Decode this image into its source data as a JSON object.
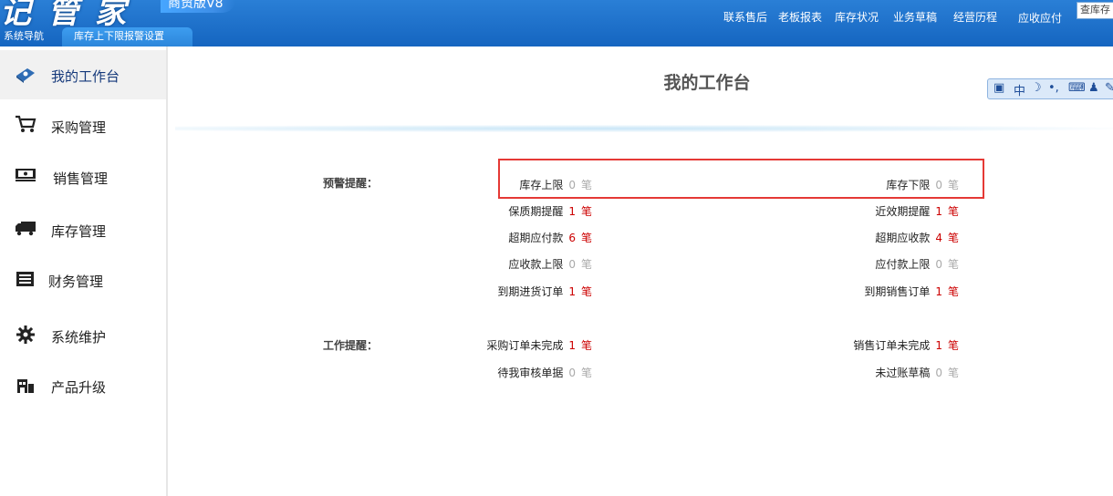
{
  "header": {
    "brand": "记管家",
    "edition": "商贸版V8",
    "tabs": [
      "系统导航",
      "库存上下限报警设置"
    ],
    "nav": [
      "联系售后",
      "老板报表",
      "库存状况",
      "业务草稿",
      "经营历程",
      "应收应付"
    ],
    "search_value": "查库存"
  },
  "sidebar": {
    "items": [
      {
        "label": "我的工作台",
        "icon": "dashboard-icon",
        "active": true
      },
      {
        "label": "采购管理",
        "icon": "cart-icon"
      },
      {
        "label": "销售管理",
        "icon": "cash-icon"
      },
      {
        "label": "库存管理",
        "icon": "truck-icon"
      },
      {
        "label": "财务管理",
        "icon": "ledger-icon"
      },
      {
        "label": "系统维护",
        "icon": "gear-icon"
      },
      {
        "label": "产品升级",
        "icon": "upgrade-icon"
      }
    ]
  },
  "main": {
    "title": "我的工作台",
    "ime": [
      "中",
      "•,",
      "⌨"
    ],
    "alerts_label": "预警提醒：",
    "work_label": "工作提醒：",
    "unit": "笔",
    "alerts": [
      {
        "left": {
          "label": "库存上限",
          "count": "0"
        },
        "right": {
          "label": "库存下限",
          "count": "0"
        }
      },
      {
        "left": {
          "label": "保质期提醒",
          "count": "1"
        },
        "right": {
          "label": "近效期提醒",
          "count": "1"
        }
      },
      {
        "left": {
          "label": "超期应付款",
          "count": "6"
        },
        "right": {
          "label": "超期应收款",
          "count": "4"
        }
      },
      {
        "left": {
          "label": "应收款上限",
          "count": "0"
        },
        "right": {
          "label": "应付款上限",
          "count": "0"
        }
      },
      {
        "left": {
          "label": "到期进货订单",
          "count": "1"
        },
        "right": {
          "label": "到期销售订单",
          "count": "1"
        }
      }
    ],
    "work": [
      {
        "left": {
          "label": "采购订单未完成",
          "count": "1"
        },
        "right": {
          "label": "销售订单未完成",
          "count": "1"
        }
      },
      {
        "left": {
          "label": "待我审核单据",
          "count": "0"
        },
        "right": {
          "label": "未过账草稿",
          "count": "0"
        }
      }
    ]
  },
  "colors": {
    "header_blue": "#1e74cf",
    "highlight_red": "#e53935",
    "nonzero_red": "#cc0000",
    "zero_gray": "#aaaaaa"
  }
}
